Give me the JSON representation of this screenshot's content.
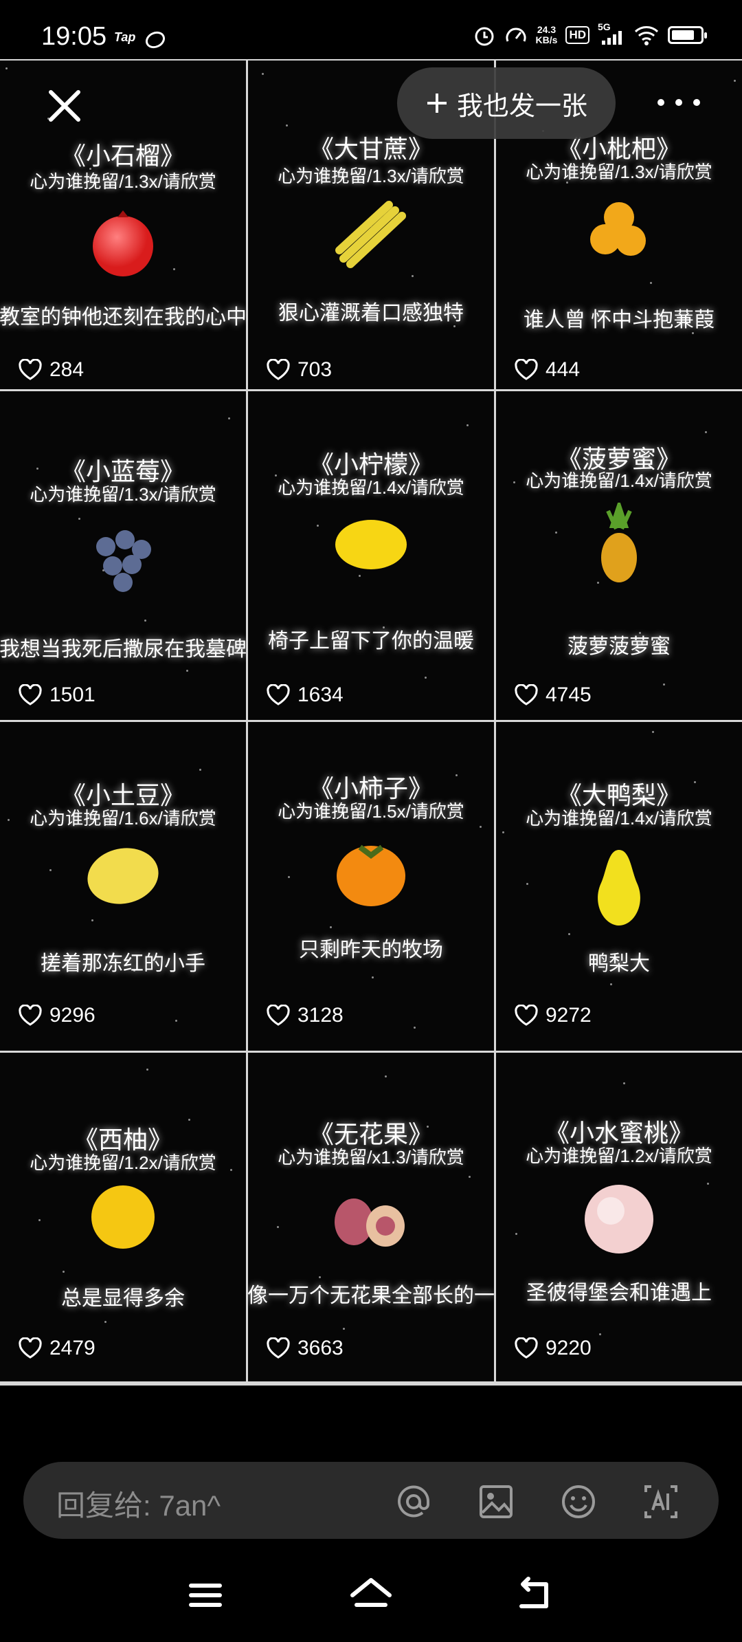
{
  "status_bar": {
    "time": "19:05",
    "app_label": "Tap",
    "net_speed_value": "24.3",
    "net_speed_unit": "KB/s",
    "hd": "HD",
    "network": "5G"
  },
  "top_bar": {
    "post_label": "我也发一张"
  },
  "cards": [
    {
      "title": "《小石榴》",
      "subtitle": "心为谁挽留/1.3x/请欣赏",
      "lyric": "教室的钟他还刻在我的心中",
      "likes": "284",
      "fruit_icon": "pomegranate-icon",
      "fruit_color": "#d91c1c"
    },
    {
      "title": "《大甘蔗》",
      "subtitle": "心为谁挽留/1.3x/请欣赏",
      "lyric": "狠心灌溉着口感独特",
      "likes": "703",
      "fruit_icon": "sugarcane-icon",
      "fruit_color": "#e6d23a"
    },
    {
      "title": "《小枇杷》",
      "subtitle": "心为谁挽留/1.3x/请欣赏",
      "lyric": "谁人曾 怀中斗抱蒹葭",
      "likes": "444",
      "fruit_icon": "loquat-icon",
      "fruit_color": "#f2a81a"
    },
    {
      "title": "《小蓝莓》",
      "subtitle": "心为谁挽留/1.3x/请欣赏",
      "lyric": "我想当我死后撒尿在我墓碑",
      "likes": "1501",
      "fruit_icon": "blueberry-icon",
      "fruit_color": "#5d6c94"
    },
    {
      "title": "《小柠檬》",
      "subtitle": "心为谁挽留/1.4x/请欣赏",
      "lyric": "椅子上留下了你的温暖",
      "likes": "1634",
      "fruit_icon": "lemon-icon",
      "fruit_color": "#f7d614"
    },
    {
      "title": "《菠萝蜜》",
      "subtitle": "心为谁挽留/1.4x/请欣赏",
      "lyric": "菠萝菠萝蜜",
      "likes": "4745",
      "fruit_icon": "pineapple-icon",
      "fruit_color": "#e0a11c"
    },
    {
      "title": "《小土豆》",
      "subtitle": "心为谁挽留/1.6x/请欣赏",
      "lyric": "搓着那冻红的小手",
      "likes": "9296",
      "fruit_icon": "potato-icon",
      "fruit_color": "#f2dc4d"
    },
    {
      "title": "《小柿子》",
      "subtitle": "心为谁挽留/1.5x/请欣赏",
      "lyric": "只剩昨天的牧场",
      "likes": "3128",
      "fruit_icon": "persimmon-icon",
      "fruit_color": "#f38a10"
    },
    {
      "title": "《大鸭梨》",
      "subtitle": "心为谁挽留/1.4x/请欣赏",
      "lyric": "鸭梨大",
      "likes": "9272",
      "fruit_icon": "pear-icon",
      "fruit_color": "#f2e01e"
    },
    {
      "title": "《西柚》",
      "subtitle": "心为谁挽留/1.2x/请欣赏",
      "lyric": "总是显得多余",
      "likes": "2479",
      "fruit_icon": "grapefruit-icon",
      "fruit_color": "#f5c712"
    },
    {
      "title": "《无花果》",
      "subtitle": "心为谁挽留/x1.3/请欣赏",
      "lyric": "像一万个无花果全部长的一",
      "likes": "3663",
      "fruit_icon": "fig-icon",
      "fruit_color": "#b8566a"
    },
    {
      "title": "《小水蜜桃》",
      "subtitle": "心为谁挽留/1.2x/请欣赏",
      "lyric": "圣彼得堡会和谁遇上",
      "likes": "9220",
      "fruit_icon": "peach-icon",
      "fruit_color": "#f3d0d0"
    }
  ],
  "reply_bar": {
    "placeholder": "回复给: 7an^"
  }
}
